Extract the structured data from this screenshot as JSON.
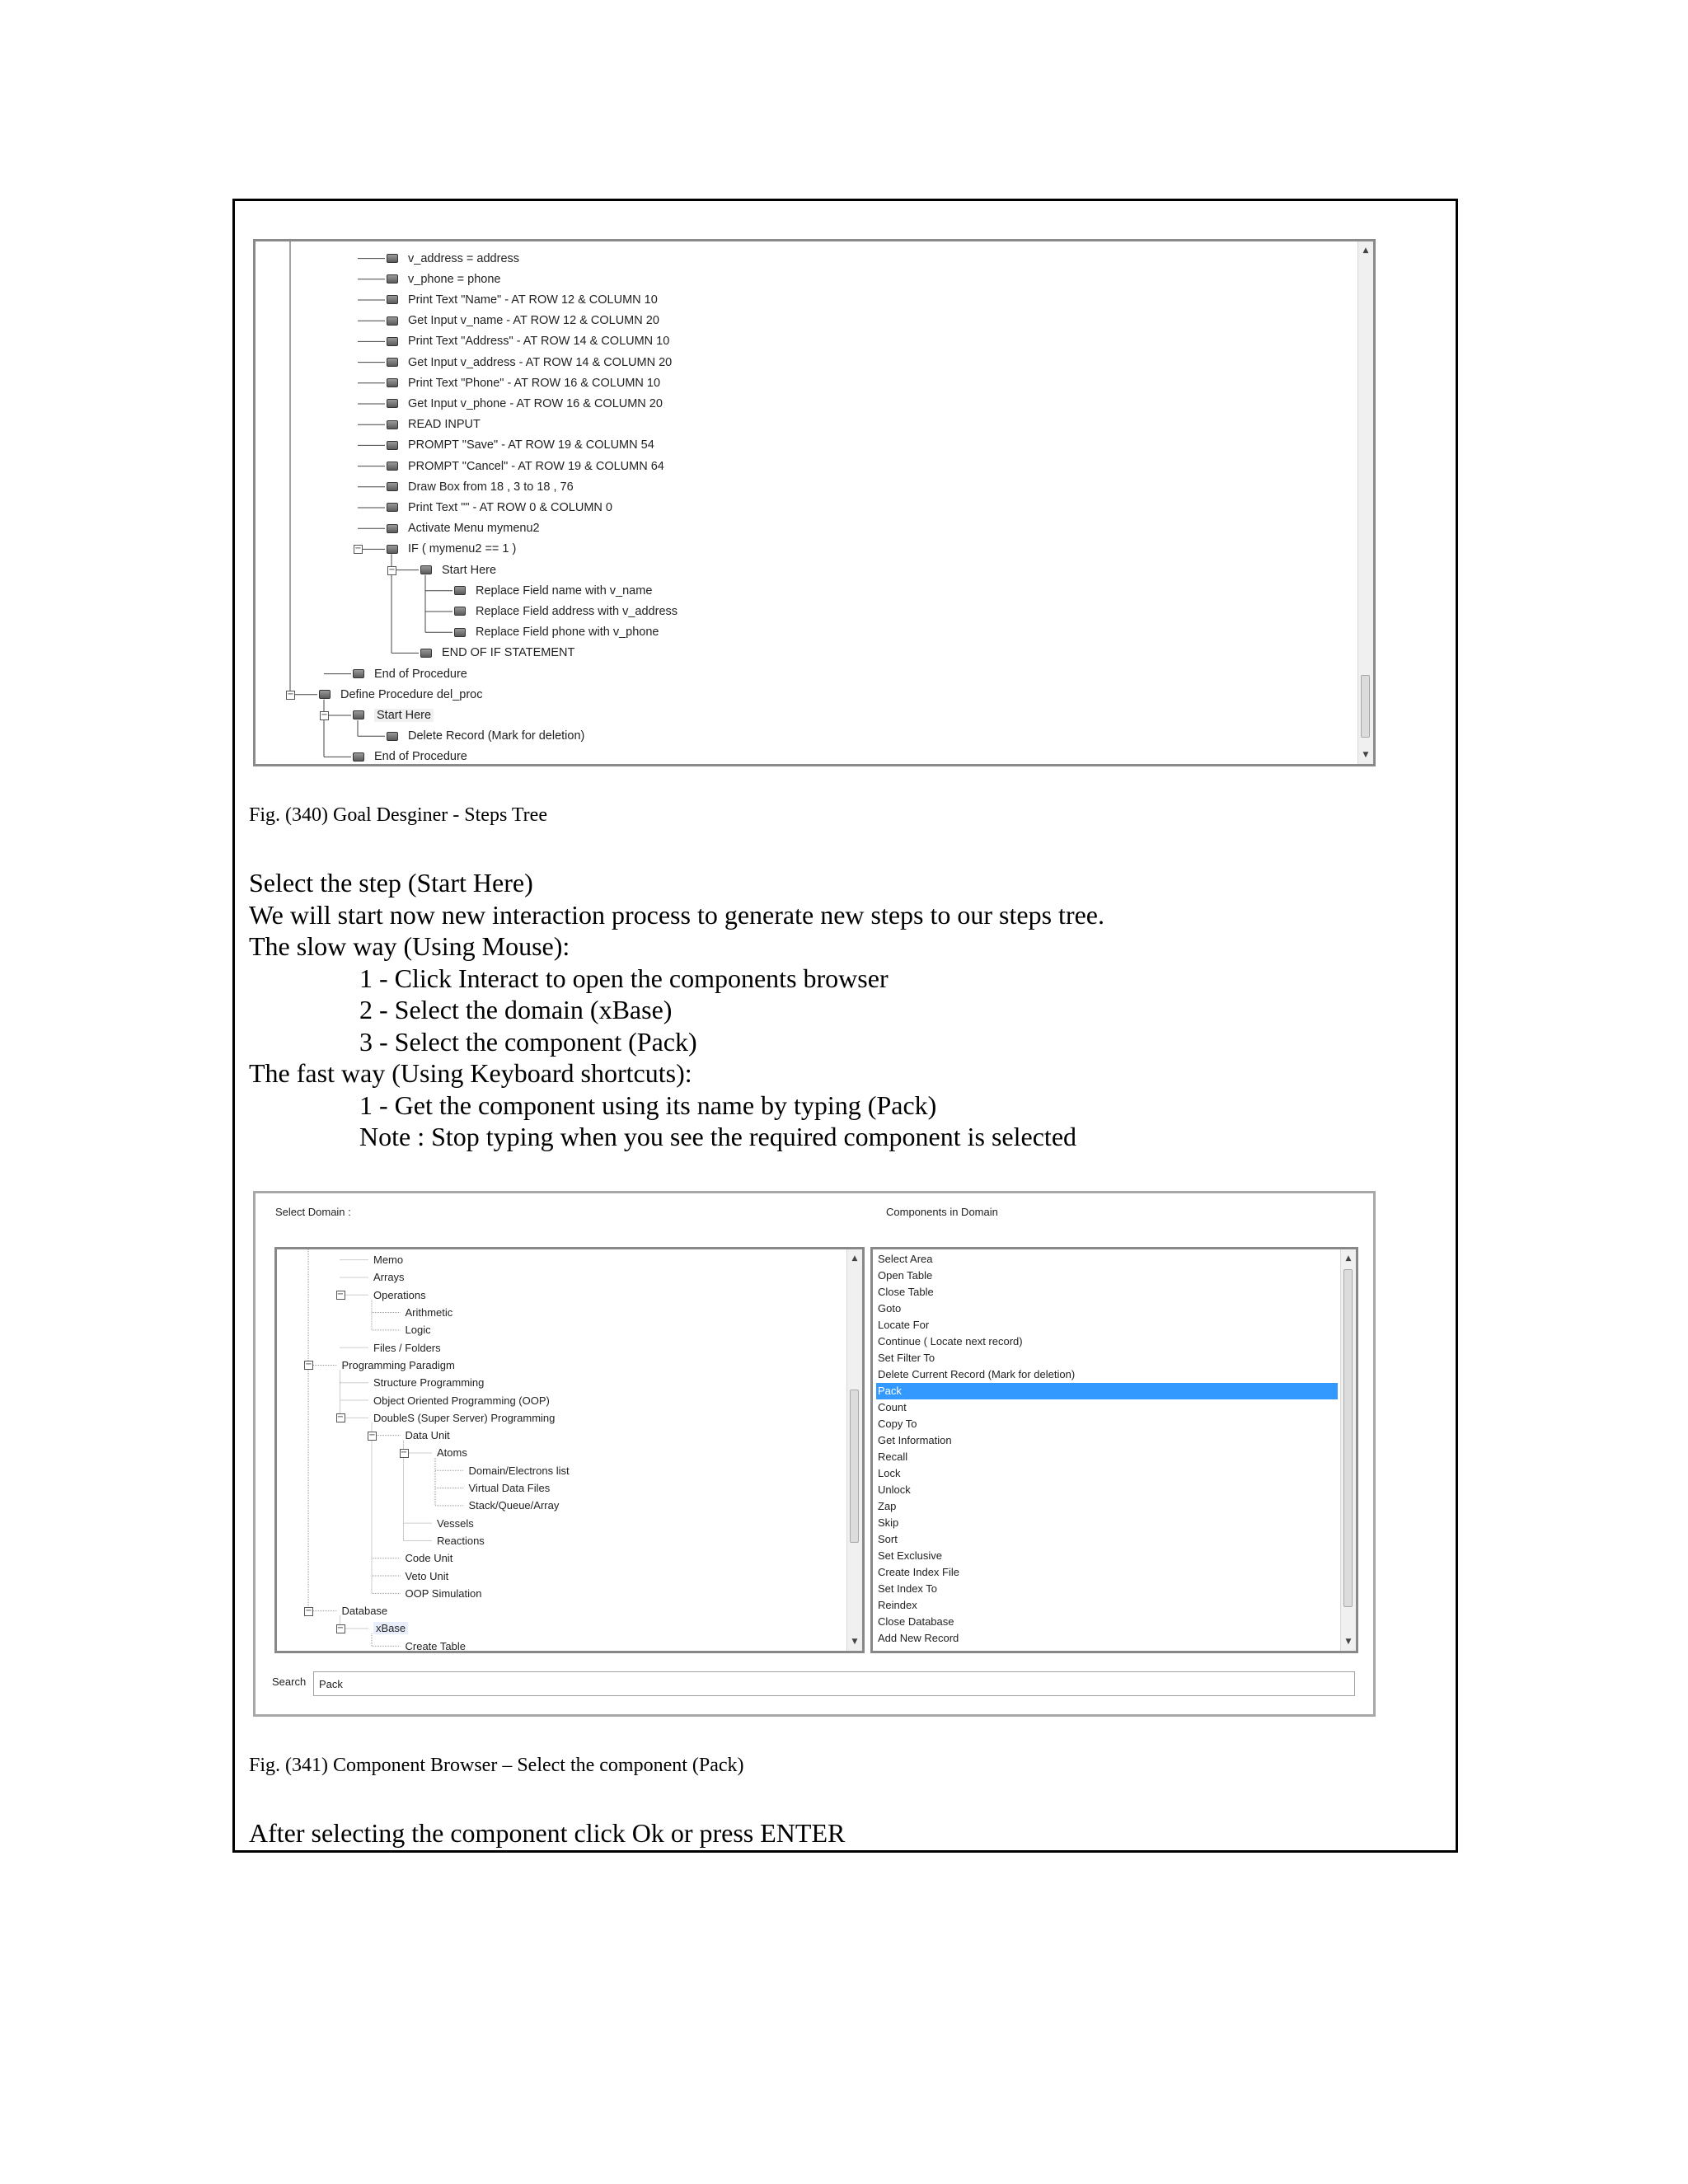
{
  "steps_tree": {
    "nodes": [
      {
        "label": "v_address = address",
        "depth": 3
      },
      {
        "label": "v_phone = phone",
        "depth": 3
      },
      {
        "label": "Print Text \"Name\" - AT ROW 12 & COLUMN 10",
        "depth": 3
      },
      {
        "label": "Get Input v_name - AT ROW 12 & COLUMN 20",
        "depth": 3
      },
      {
        "label": "Print Text \"Address\" - AT ROW 14 & COLUMN 10",
        "depth": 3
      },
      {
        "label": "Get Input v_address - AT ROW 14 & COLUMN 20",
        "depth": 3
      },
      {
        "label": "Print Text \"Phone\" - AT ROW 16 & COLUMN 10",
        "depth": 3
      },
      {
        "label": "Get Input v_phone - AT ROW 16 & COLUMN 20",
        "depth": 3
      },
      {
        "label": "READ INPUT",
        "depth": 3
      },
      {
        "label": "PROMPT \"Save\" - AT ROW 19 & COLUMN 54",
        "depth": 3
      },
      {
        "label": "PROMPT \"Cancel\" - AT ROW 19 & COLUMN 64",
        "depth": 3
      },
      {
        "label": "Draw Box from 18 , 3 to 18 , 76",
        "depth": 3
      },
      {
        "label": "Print Text \"\" - AT ROW 0 & COLUMN 0",
        "depth": 3
      },
      {
        "label": "Activate Menu mymenu2",
        "depth": 3
      },
      {
        "label": "IF ( mymenu2 == 1 )",
        "depth": 3,
        "expander": true
      },
      {
        "label": "Start Here",
        "depth": 4,
        "expander": true
      },
      {
        "label": "Replace Field name with v_name",
        "depth": 5
      },
      {
        "label": "Replace Field address with v_address",
        "depth": 5
      },
      {
        "label": "Replace Field phone with v_phone",
        "depth": 5
      },
      {
        "label": "END OF IF STATEMENT",
        "depth": 4
      },
      {
        "label": "End of Procedure",
        "depth": 2
      },
      {
        "label": "Define Procedure del_proc",
        "depth": 1,
        "expander": true
      },
      {
        "label": "Start Here",
        "depth": 2,
        "expander": true,
        "highlight": true
      },
      {
        "label": "Delete Record (Mark for deletion)",
        "depth": 3
      },
      {
        "label": "End of Procedure",
        "depth": 2
      }
    ]
  },
  "fig340_caption": "Fig. (340) Goal Desginer - Steps Tree",
  "instructions": {
    "line1": "Select the step (Start Here)",
    "line2": "We will start now new interaction process to generate new steps to our steps tree.",
    "slow_heading": "The slow way (Using Mouse):",
    "slow_steps": [
      "1 - Click Interact to open the components browser",
      "2 - Select the domain (xBase)",
      "3 - Select the component (Pack)"
    ],
    "fast_heading": "The fast way (Using Keyboard shortcuts):",
    "fast_steps": [
      "1 - Get the component using its name by typing (Pack)",
      "Note : Stop typing when you see the required component is selected"
    ]
  },
  "component_browser": {
    "select_domain_label": "Select Domain :",
    "components_label": "Components in Domain",
    "domain_tree": [
      {
        "label": "Memo",
        "depth": 2
      },
      {
        "label": "Arrays",
        "depth": 2
      },
      {
        "label": "Operations",
        "depth": 2,
        "expander": true
      },
      {
        "label": "Arithmetic",
        "depth": 3
      },
      {
        "label": "Logic",
        "depth": 3
      },
      {
        "label": "Files / Folders",
        "depth": 2
      },
      {
        "label": "Programming Paradigm",
        "depth": 1,
        "expander": true
      },
      {
        "label": "Structure Programming",
        "depth": 2
      },
      {
        "label": "Object Oriented Programming (OOP)",
        "depth": 2
      },
      {
        "label": "DoubleS (Super Server) Programming",
        "depth": 2,
        "expander": true
      },
      {
        "label": "Data Unit",
        "depth": 3,
        "expander": true
      },
      {
        "label": "Atoms",
        "depth": 4,
        "expander": true
      },
      {
        "label": "Domain/Electrons list",
        "depth": 5
      },
      {
        "label": "Virtual Data Files",
        "depth": 5
      },
      {
        "label": "Stack/Queue/Array",
        "depth": 5
      },
      {
        "label": "Vessels",
        "depth": 4
      },
      {
        "label": "Reactions",
        "depth": 4
      },
      {
        "label": "Code Unit",
        "depth": 3
      },
      {
        "label": "Veto Unit",
        "depth": 3
      },
      {
        "label": "OOP Simulation",
        "depth": 3
      },
      {
        "label": "Database",
        "depth": 1,
        "expander": true
      },
      {
        "label": "xBase",
        "depth": 2,
        "expander": true,
        "highlight": true
      },
      {
        "label": "Create Table",
        "depth": 3
      }
    ],
    "components": [
      "Select Area",
      "Open Table",
      "Close Table",
      "Goto",
      "Locate For",
      "Continue ( Locate next record)",
      "Set Filter To",
      "Delete Current Record (Mark for deletion)",
      "Pack",
      "Count",
      "Copy To",
      "Get Information",
      "Recall",
      "Lock",
      "Unlock",
      "Zap",
      "Skip",
      "Sort",
      "Set Exclusive",
      "Create Index File",
      "Set Index To",
      "Reindex",
      "Close Database",
      "Add New Record"
    ],
    "selected_component": "Pack",
    "search_label": "Search",
    "search_value": "Pack"
  },
  "fig341_caption": "Fig. (341) Component Browser – Select the component (Pack)",
  "final_line": "After selecting the component click Ok or press ENTER"
}
